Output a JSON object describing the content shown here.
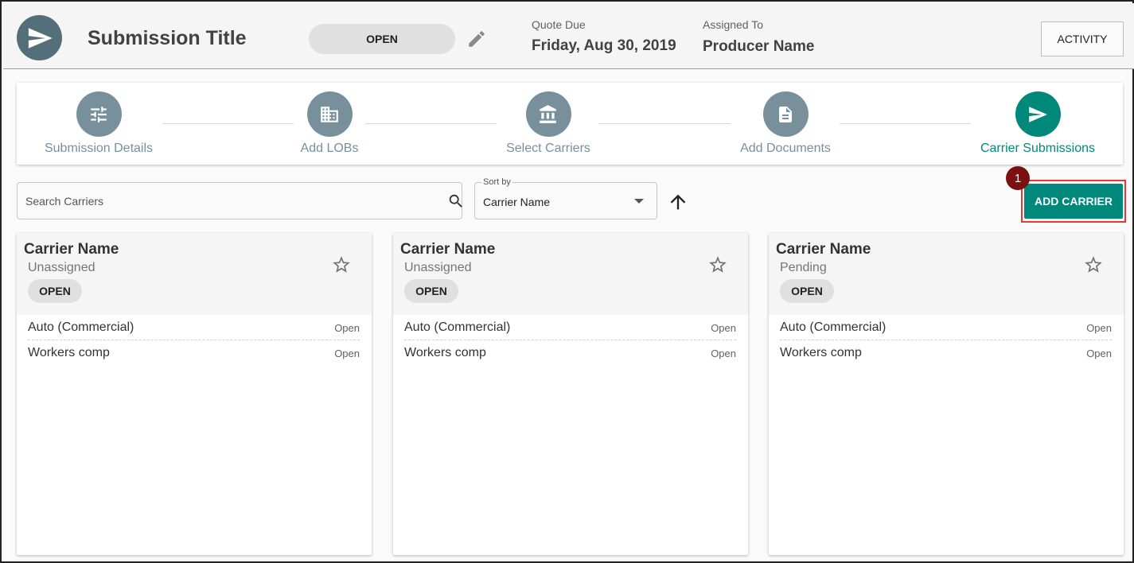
{
  "header": {
    "title": "Submission Title",
    "status": "OPEN",
    "quote_due_label": "Quote Due",
    "quote_due_value": "Friday, Aug 30, 2019",
    "assigned_label": "Assigned To",
    "assigned_value": "Producer Name",
    "activity_label": "ACTIVITY"
  },
  "stepper": {
    "steps": [
      {
        "label": "Submission Details",
        "icon": "tune-icon"
      },
      {
        "label": "Add LOBs",
        "icon": "building-icon"
      },
      {
        "label": "Select Carriers",
        "icon": "bank-icon"
      },
      {
        "label": "Add Documents",
        "icon": "document-icon"
      },
      {
        "label": "Carrier Submissions",
        "icon": "send-icon",
        "active": true
      }
    ]
  },
  "toolbar": {
    "search_placeholder": "Search Carriers",
    "sort_label": "Sort by",
    "sort_value": "Carrier Name",
    "add_carrier_label": "ADD CARRIER",
    "annotation_number": "1"
  },
  "cards": [
    {
      "name": "Carrier Name",
      "status": "Unassigned",
      "pill": "OPEN",
      "lobs": [
        {
          "name": "Auto (Commercial)",
          "status": "Open"
        },
        {
          "name": "Workers comp",
          "status": "Open"
        }
      ]
    },
    {
      "name": "Carrier Name",
      "status": "Unassigned",
      "pill": "OPEN",
      "lobs": [
        {
          "name": "Auto (Commercial)",
          "status": "Open"
        },
        {
          "name": "Workers comp",
          "status": "Open"
        }
      ]
    },
    {
      "name": "Carrier Name",
      "status": "Pending",
      "pill": "OPEN",
      "lobs": [
        {
          "name": "Auto (Commercial)",
          "status": "Open"
        },
        {
          "name": "Workers comp",
          "status": "Open"
        }
      ]
    }
  ],
  "colors": {
    "accent": "#00897b",
    "step_inactive": "#78909c",
    "annotation_badge": "#7b1010",
    "annotation_outline": "#e53935"
  }
}
